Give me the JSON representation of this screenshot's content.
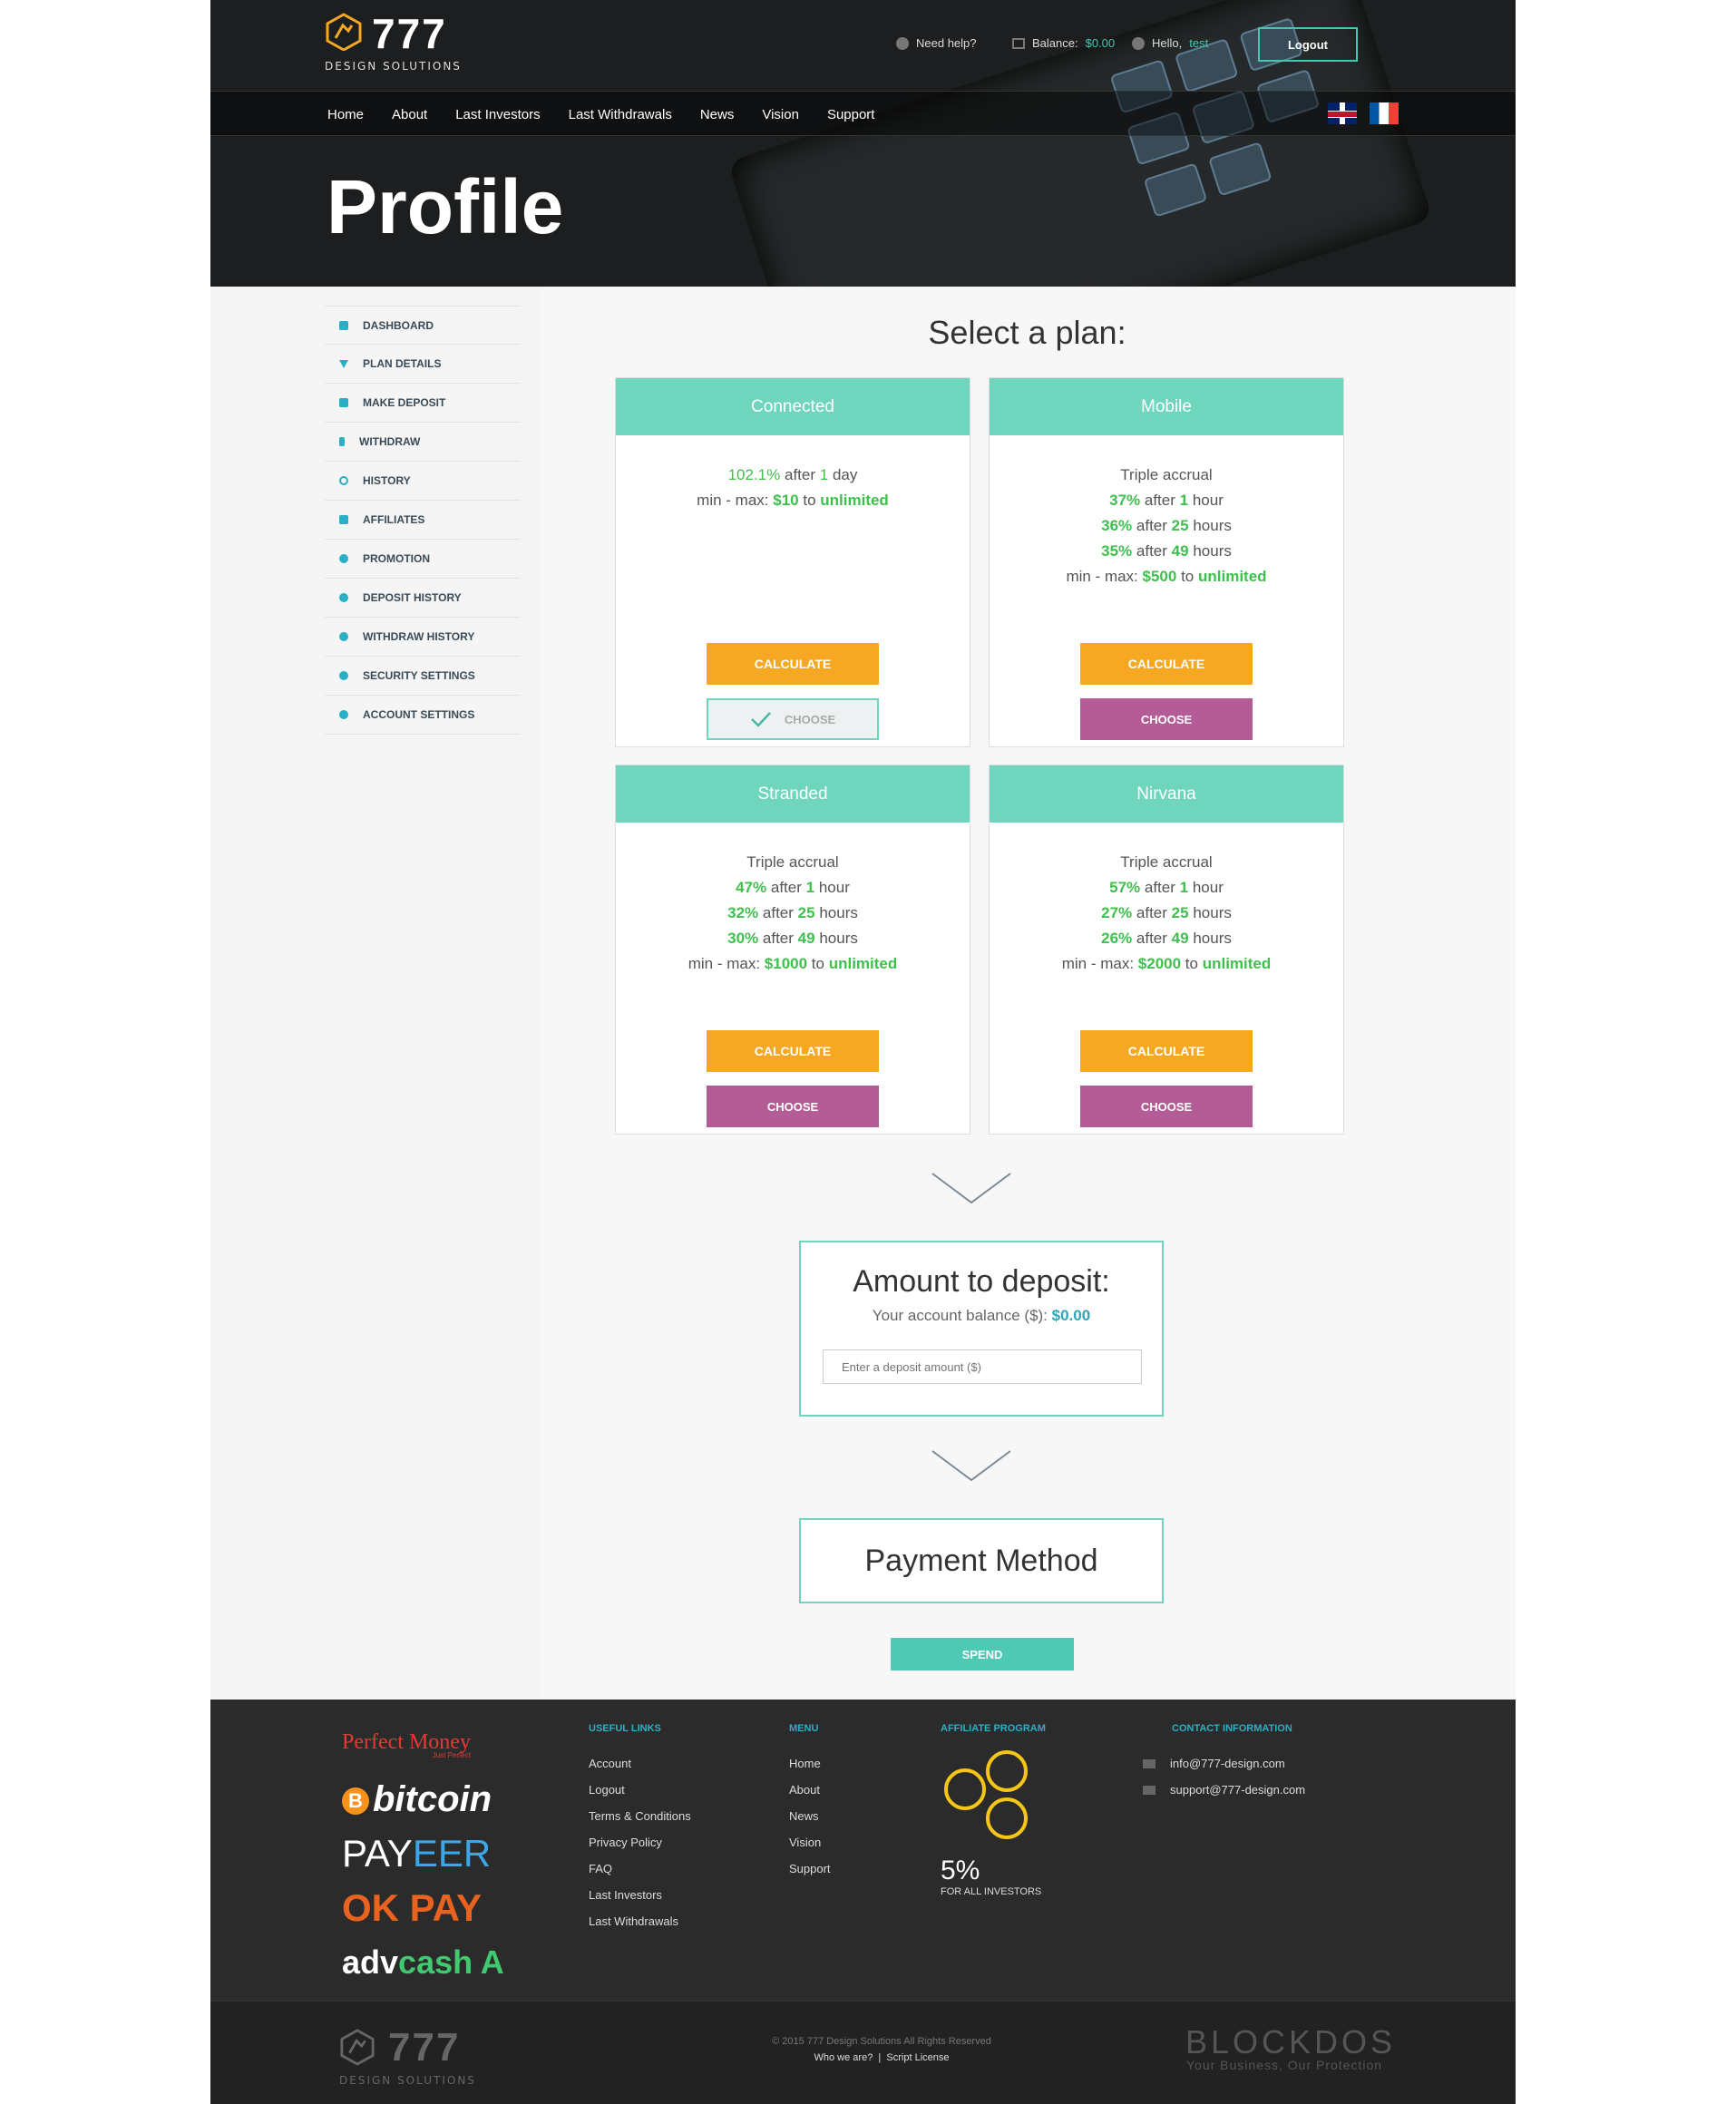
{
  "header": {
    "logo_number": "777",
    "logo_subtitle": "DESIGN SOLUTIONS",
    "help_label": "Need help?",
    "balance_label": "Balance:",
    "balance_value": "$0.00",
    "hello_label": "Hello,",
    "username": "test",
    "logout_label": "Logout",
    "nav": [
      "Home",
      "About",
      "Last Investors",
      "Last Withdrawals",
      "News",
      "Vision",
      "Support"
    ],
    "page_title": "Profile"
  },
  "sidebar": {
    "items": [
      {
        "label": "DASHBOARD",
        "icon": "dashboard-icon"
      },
      {
        "label": "PLAN DETAILS",
        "icon": "plan-details-icon"
      },
      {
        "label": "MAKE DEPOSIT",
        "icon": "make-deposit-icon"
      },
      {
        "label": "WITHDRAW",
        "icon": "withdraw-icon"
      },
      {
        "label": "HISTORY",
        "icon": "history-icon"
      },
      {
        "label": "AFFILIATES",
        "icon": "affiliates-icon"
      },
      {
        "label": "PROMOTION",
        "icon": "promotion-icon"
      },
      {
        "label": "DEPOSIT HISTORY",
        "icon": "deposit-history-icon"
      },
      {
        "label": "WITHDRAW HISTORY",
        "icon": "withdraw-history-icon"
      },
      {
        "label": "SECURITY SETTINGS",
        "icon": "security-settings-icon"
      },
      {
        "label": "ACCOUNT SETTINGS",
        "icon": "account-settings-icon"
      }
    ]
  },
  "main": {
    "select_title": "Select a plan:",
    "calculate_label": "CALCULATE",
    "choose_label": "CHOOSE",
    "plans": [
      {
        "name": "Connected",
        "line1_pct": "102.1%",
        "line1_after": "after",
        "line1_num": "1",
        "line1_unit": "day",
        "min_label": "min - max:",
        "min": "$10",
        "to": "to",
        "max": "unlimited",
        "selected": true
      },
      {
        "name": "Mobile",
        "triple": "Triple accrual",
        "rates": [
          {
            "pct": "37%",
            "after": "after",
            "num": "1",
            "unit": "hour"
          },
          {
            "pct": "36%",
            "after": "after",
            "num": "25",
            "unit": "hours"
          },
          {
            "pct": "35%",
            "after": "after",
            "num": "49",
            "unit": "hours"
          }
        ],
        "min_label": "min - max:",
        "min": "$500",
        "to": "to",
        "max": "unlimited",
        "selected": false
      },
      {
        "name": "Stranded",
        "triple": "Triple accrual",
        "rates": [
          {
            "pct": "47%",
            "after": "after",
            "num": "1",
            "unit": "hour"
          },
          {
            "pct": "32%",
            "after": "after",
            "num": "25",
            "unit": "hours"
          },
          {
            "pct": "30%",
            "after": "after",
            "num": "49",
            "unit": "hours"
          }
        ],
        "min_label": "min - max:",
        "min": "$1000",
        "to": "to",
        "max": "unlimited",
        "selected": false
      },
      {
        "name": "Nirvana",
        "triple": "Triple accrual",
        "rates": [
          {
            "pct": "57%",
            "after": "after",
            "num": "1",
            "unit": "hour"
          },
          {
            "pct": "27%",
            "after": "after",
            "num": "25",
            "unit": "hours"
          },
          {
            "pct": "26%",
            "after": "after",
            "num": "49",
            "unit": "hours"
          }
        ],
        "min_label": "min - max:",
        "min": "$2000",
        "to": "to",
        "max": "unlimited",
        "selected": false
      }
    ],
    "deposit": {
      "title": "Amount to deposit:",
      "balance_label": "Your account balance ($):",
      "balance_value": "$0.00",
      "placeholder": "Enter a deposit amount ($)"
    },
    "payment_title": "Payment Method",
    "spend_label": "SPEND"
  },
  "footer": {
    "payment_logos": {
      "perfect_money": "Perfect Money",
      "perfect_money_tag": "Just Perfect",
      "bitcoin": "bitcoin",
      "payeer_a": "PAY",
      "payeer_b": "EER",
      "okpay": "OK PAY",
      "advcash_a": "adv",
      "advcash_b": "cash"
    },
    "useful_links_title": "USEFUL LINKS",
    "useful_links": [
      "Account",
      "Logout",
      "Terms & Conditions",
      "Privacy Policy",
      "FAQ",
      "Last Investors",
      "Last Withdrawals"
    ],
    "menu_title": "MENU",
    "menu_links": [
      "Home",
      "About",
      "News",
      "Vision",
      "Support"
    ],
    "affiliate_title": "AFFILIATE PROGRAM",
    "affiliate_pct": "5%",
    "affiliate_sub": "FOR ALL INVESTORS",
    "contact_title": "CONTACT INFORMATION",
    "contacts": [
      "info@777-design.com",
      "support@777-design.com"
    ],
    "bottom": {
      "logo_number": "777",
      "logo_subtitle": "DESIGN SOLUTIONS",
      "copyright": "© 2015 777 Design Solutions All Rights Reserved",
      "who": "Who we are?",
      "license": "Script License",
      "blockdos": "BLOCKDOS",
      "blockdos_sub": "Your Business, Our Protection"
    }
  },
  "colors": {
    "accent_teal": "#6fd6bd",
    "calculate_orange": "#f7a823",
    "choose_purple": "#b45c96",
    "rate_green": "#3ec04c"
  }
}
